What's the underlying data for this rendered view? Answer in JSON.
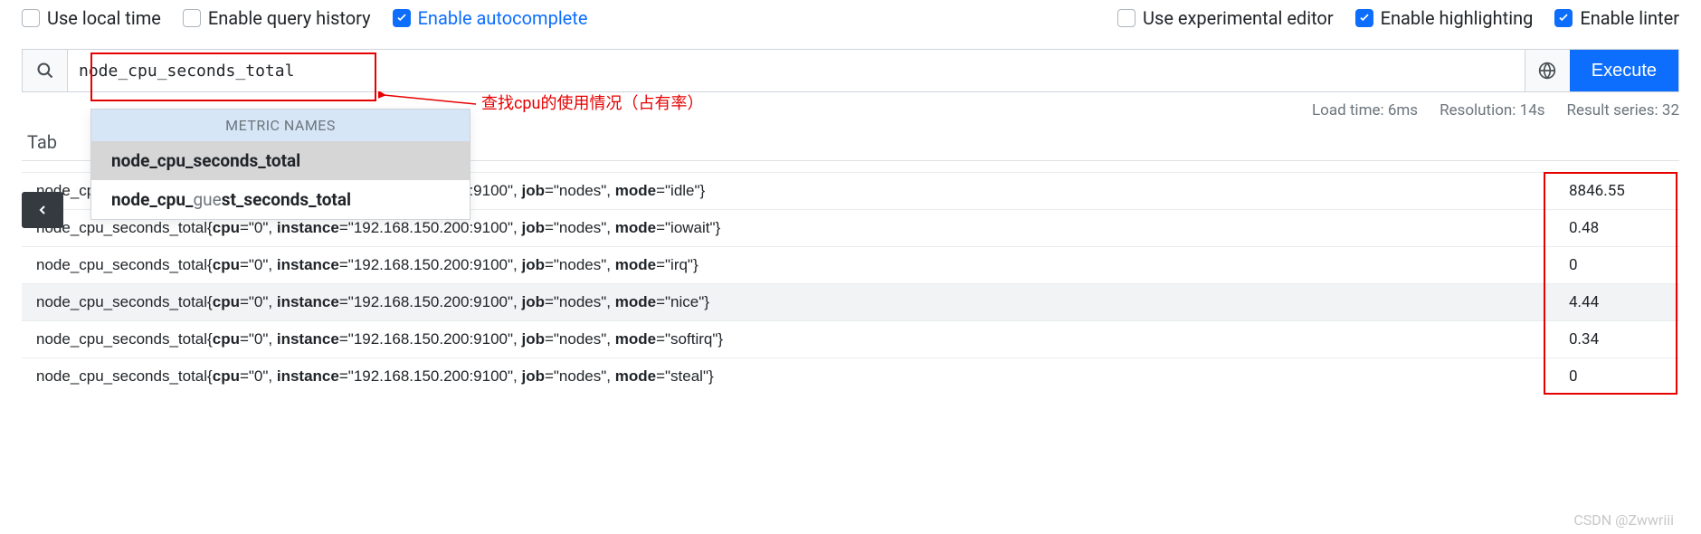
{
  "options": {
    "use_local_time": "Use local time",
    "enable_history": "Enable query history",
    "enable_autocomplete": "Enable autocomplete",
    "use_experimental": "Use experimental editor",
    "enable_highlighting": "Enable highlighting",
    "enable_linter": "Enable linter"
  },
  "query": {
    "value": "node_cpu_seconds_total",
    "execute_label": "Execute"
  },
  "annotation": {
    "text": "查找cpu的使用情况（占有率）"
  },
  "stats": {
    "load_time": "Load time: 6ms",
    "resolution": "Resolution: 14s",
    "result_series": "Result series: 32"
  },
  "tab": {
    "label": "Tab"
  },
  "dropdown": {
    "header": "METRIC NAMES",
    "items": [
      {
        "bold": "node_cpu_seconds_total",
        "rest": ""
      },
      {
        "bold": "node_cpu_",
        "mid": "gue",
        "rest": "st_seconds_total"
      }
    ]
  },
  "results": {
    "rows": [
      {
        "metric": "node_cpu_seconds_total",
        "labels": "cpu=\"0\", instance=\"192.168.150.200:9100\", job=\"nodes\", mode=\"idle\"",
        "value": "8846.55"
      },
      {
        "metric": "node_cpu_seconds_total",
        "labels": "cpu=\"0\", instance=\"192.168.150.200:9100\", job=\"nodes\", mode=\"iowait\"",
        "value": "0.48"
      },
      {
        "metric": "node_cpu_seconds_total",
        "labels": "cpu=\"0\", instance=\"192.168.150.200:9100\", job=\"nodes\", mode=\"irq\"",
        "value": "0"
      },
      {
        "metric": "node_cpu_seconds_total",
        "labels": "cpu=\"0\", instance=\"192.168.150.200:9100\", job=\"nodes\", mode=\"nice\"",
        "value": "4.44"
      },
      {
        "metric": "node_cpu_seconds_total",
        "labels": "cpu=\"0\", instance=\"192.168.150.200:9100\", job=\"nodes\", mode=\"softirq\"",
        "value": "0.34"
      },
      {
        "metric": "node_cpu_seconds_total",
        "labels": "cpu=\"0\", instance=\"192.168.150.200:9100\", job=\"nodes\", mode=\"steal\"",
        "value": "0"
      }
    ]
  },
  "watermark": "CSDN @Zwwriii"
}
